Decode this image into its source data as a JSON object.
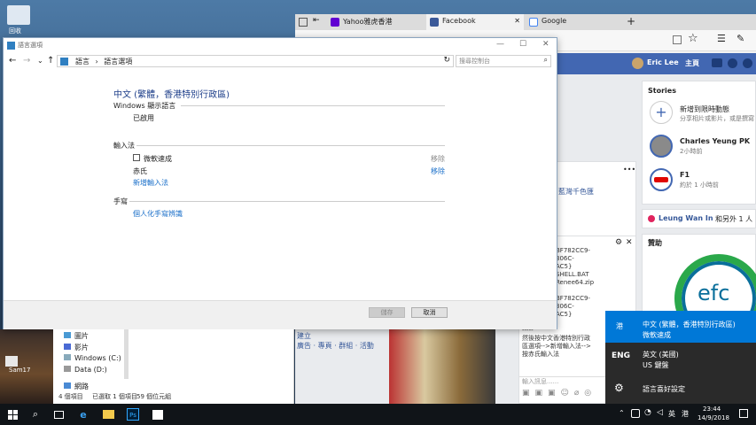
{
  "desktop": {
    "recycle_label": "回收",
    "file_icon_label": "Sam17"
  },
  "browser": {
    "tabs": [
      {
        "label": "Yahoo雅虎香港",
        "color": "#6001d2"
      },
      {
        "label": "Facebook",
        "color": "#3b5998"
      },
      {
        "label": "Google",
        "color": "#ffffff"
      }
    ],
    "tab_close": "✕",
    "new_tab": "+",
    "fb": {
      "user": "Eric Lee",
      "home": "主頁",
      "stories_title": "Stories",
      "add_story_title": "新增到限時動態",
      "add_story_sub": "分享相片或影片，或是撰寫",
      "story1_name": "Charles Yeung PK",
      "story1_time": "2小時前",
      "story2_name": "F1",
      "story2_time": "約於 1 小時前",
      "friends_text_name": "Leung Wan In",
      "friends_text_rest": "和另外 1 人",
      "sponsored": "贊助",
      "post_snippet": "藍灣千色匯",
      "more": "•••",
      "chat_lines": [
        "BF782CC9-",
        "306C-",
        "AC5}",
        "SHELL.BAT",
        "Renee64.zip",
        "",
        "BF782CC9-",
        "306C-",
        "AC5}",
        "",
        "-----",
        "然後按中文香港特別行政",
        "區選項-->新增輸入法-->",
        "按赤氏輸入法"
      ],
      "chat_input_placeholder": "輸入訊息......",
      "bottom_link_1": "建立",
      "bottom_links": "廣告 · 專頁 · 群組 · 活動",
      "logo_text": "efc"
    }
  },
  "settings": {
    "title": "語言選項",
    "breadcrumb_1": "語言",
    "breadcrumb_sep": "›",
    "breadcrumb_2": "語言選項",
    "search_placeholder": "搜尋控制台",
    "heading": "中文 (繁體，香港特別行政區)",
    "display_lang_label": "Windows 顯示語言",
    "display_lang_value": "已啟用",
    "input_method_label": "輸入法",
    "ime_1": "微軟速成",
    "ime_1_remove": "移除",
    "ime_2": "赤氏",
    "ime_2_remove": "移除",
    "add_ime": "新增輸入法",
    "handwriting_label": "手寫",
    "personalize_hw": "個人化手寫辨識",
    "save_button": "儲存",
    "cancel_button": "取消"
  },
  "explorer": {
    "items": [
      "圖片",
      "影片",
      "Windows (C:)",
      "Data (D:)",
      "網路"
    ],
    "status_count": "4 個項目",
    "status_selected": "已選取 1 個項目",
    "status_size": "59 個位元組"
  },
  "language_flyout": {
    "item1_code": "港",
    "item1_name": "中文 (繁體，香港特別行政區)",
    "item1_sub": "微軟速成",
    "item2_code": "ENG",
    "item2_name": "英文 (美國)",
    "item2_sub": "US 鍵盤",
    "settings_label": "語言喜好設定",
    "accent": "#0078d7"
  },
  "taskbar": {
    "lang_indicator": "英",
    "ime_indicator": "港",
    "time": "23:44",
    "date": "14/9/2018",
    "ps_label": "Ps"
  }
}
